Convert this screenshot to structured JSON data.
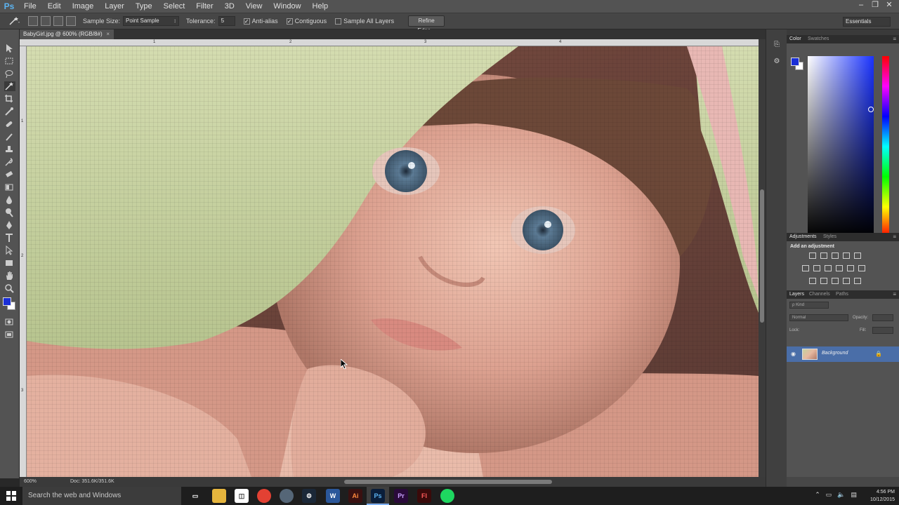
{
  "app": {
    "logo": "Ps"
  },
  "menu": [
    "File",
    "Edit",
    "Image",
    "Layer",
    "Type",
    "Select",
    "Filter",
    "3D",
    "View",
    "Window",
    "Help"
  ],
  "window_controls": [
    "–",
    "❐",
    "✕"
  ],
  "options": {
    "sample_size_label": "Sample Size:",
    "sample_size_value": "Point Sample",
    "tolerance_label": "Tolerance:",
    "tolerance_value": "5",
    "anti_alias": "Anti-alias",
    "contiguous": "Contiguous",
    "sample_all_layers": "Sample All Layers",
    "refine_edge": "Refine Edge...",
    "workspace": "Essentials"
  },
  "document": {
    "tab_title": "BabyGirl.jpg @ 600% (RGB/8#)",
    "close": "×",
    "ruler_top_ticks": [
      "1",
      "2",
      "3",
      "4"
    ],
    "ruler_left_ticks": [
      "1",
      "2",
      "3"
    ]
  },
  "status": {
    "zoom": "600%",
    "doc_size": "Doc: 351.6K/351.6K"
  },
  "panels": {
    "color_tabs": [
      "Color",
      "Swatches"
    ],
    "adj_tabs": [
      "Adjustments",
      "Styles"
    ],
    "adj_title": "Add an adjustment",
    "layers_tabs": [
      "Layers",
      "Channels",
      "Paths"
    ],
    "kind_label": "ρ Kind",
    "blend_mode": "Normal",
    "opacity_label": "Opacity:",
    "lock_label": "Lock:",
    "fill_label": "Fill:",
    "layer_name": "Background"
  },
  "taskbar": {
    "search_placeholder": "Search the web and Windows",
    "time": "4:56 PM",
    "date": "10/12/2015"
  },
  "colors": {
    "foreground": "#1a2fd6",
    "background": "#ffffff",
    "layer_selected": "#4a6ea8"
  }
}
